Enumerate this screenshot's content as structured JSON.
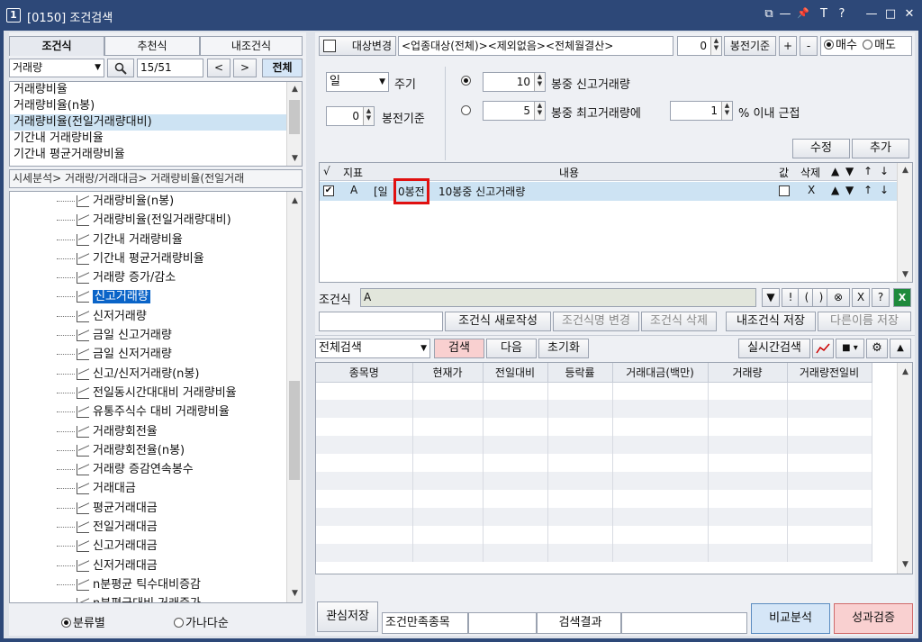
{
  "window": {
    "number": "1",
    "title": "[0150] 조건검색"
  },
  "title_controls": [
    "⧉",
    "—",
    "📌",
    "T",
    "?",
    "—",
    "□",
    "✕"
  ],
  "left": {
    "tabs": [
      "조건식",
      "추천식",
      "내조건식"
    ],
    "category_select": "거래량",
    "counter": "15/51",
    "prev": "<",
    "next": ">",
    "all_button": "전체",
    "indicators": [
      "거래량비율",
      "거래량비율(n봉)",
      "거래량비율(전일거래량대비)",
      "기간내 거래량비율",
      "기간내 평균거래량비율"
    ],
    "breadcrumb": "시세분석> 거래량/거래대금> 거래량비율(전일거래",
    "tree": [
      "거래량비율(n봉)",
      "거래량비율(전일거래량대비)",
      "기간내 거래량비율",
      "기간내 평균거래량비율",
      "거래량 증가/감소",
      "신고거래량",
      "신저거래량",
      "금일 신고거래량",
      "금일 신저거래량",
      "신고/신저거래량(n봉)",
      "전일동시간대대비 거래량비율",
      "유통주식수 대비 거래량비율",
      "거래량회전율",
      "거래량회전율(n봉)",
      "거래량 증감연속봉수",
      "거래대금",
      "평균거래대금",
      "전일거래대금",
      "신고거래대금",
      "신저거래대금",
      "n분평균 틱수대비증감",
      "n분평균대비 거래증가"
    ],
    "radio_category": "분류별",
    "radio_alpha": "가나다순"
  },
  "right": {
    "target_button": "대상변경",
    "target_text": "<업종대상(전체)><제외없음><전체월결산>",
    "bong_value": "0",
    "bong_label": "봉전기준",
    "plus": "+",
    "minus": "-",
    "buy": "매수",
    "sell": "매도",
    "period_select": "일",
    "period_label": "주기",
    "ref_value": "0",
    "ref_label": "봉전기준",
    "opt1_value": "10",
    "opt1_label": "봉중 신고거래량",
    "opt2_value": "5",
    "opt2_label": "봉중 최고거래량에",
    "opt2_pct": "1",
    "opt2_suffix": "% 이내 근접",
    "modify": "수정",
    "add": "추가",
    "cond_headers": [
      "√",
      "지표",
      "내용",
      "값",
      "삭제",
      "▲",
      "▼",
      "↑",
      "↓"
    ],
    "cond_row": {
      "ind": "A",
      "prefix": "[일",
      "hl": "0봉전",
      "rest": "10봉중 신고거래량",
      "del": "X"
    },
    "formula_label": "조건식",
    "formula_value": "A",
    "formula_ops": [
      "▼",
      "!",
      "(",
      ")",
      "⊗",
      "X",
      "?"
    ],
    "new_formula": "조건식 새로작성",
    "rename": "조건식명 변경",
    "delete": "조건식 삭제",
    "save_my": "내조건식 저장",
    "save_as": "다른이름 저장",
    "search_scope": "전체검색",
    "search": "검색",
    "next_btn": "다음",
    "reset": "초기화",
    "realtime": "실시간검색",
    "result_headers": [
      "종목명",
      "현재가",
      "전일대비",
      "등락률",
      "거래대금(백만)",
      "거래량",
      "거래량전일비"
    ],
    "interest_save": "관심저장",
    "satisfied": "조건만족종목",
    "result_label": "검색결과",
    "compare": "비교분석",
    "perf": "성과검증"
  },
  "colors": {
    "titlebar": "#2d4878",
    "selected": "#cde3f3",
    "tree_sel": "#0a64c8",
    "highlight_box": "#e01010",
    "perf_btn": "#f9d0d0",
    "compare_btn": "#d5e6f7"
  }
}
